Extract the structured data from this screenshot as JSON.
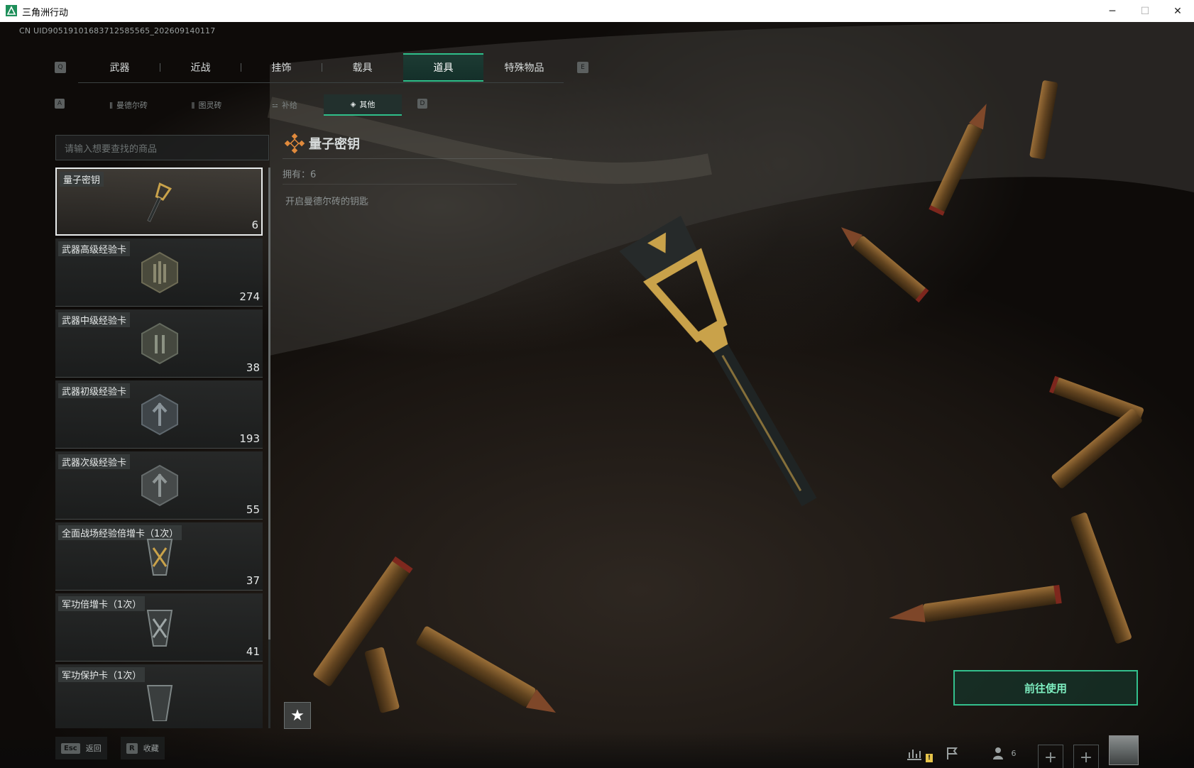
{
  "window": {
    "title": "三角洲行动"
  },
  "uid": "CN UID9051910168371258556​5_202609140117",
  "main_tabs": [
    "武器",
    "近战",
    "挂饰",
    "载具",
    "道具",
    "特殊物品"
  ],
  "main_tab_keys": {
    "prev": "Q",
    "next": "E"
  },
  "sub_tabs": [
    {
      "label": "曼德尔砖",
      "icon": "ǁ"
    },
    {
      "label": "图灵砖",
      "icon": "ǁ"
    },
    {
      "label": "补给",
      "icon": "⚍"
    },
    {
      "label": "其他",
      "icon": "◈"
    }
  ],
  "sub_tab_keys": {
    "prev": "A",
    "next": "D"
  },
  "search": {
    "placeholder": "请输入想要查找的商品"
  },
  "items": [
    {
      "name": "量子密钥",
      "count": "6"
    },
    {
      "name": "武器高级经验卡",
      "count": "274"
    },
    {
      "name": "武器中级经验卡",
      "count": "38"
    },
    {
      "name": "武器初级经验卡",
      "count": "193"
    },
    {
      "name": "武器次级经验卡",
      "count": "55"
    },
    {
      "name": "全面战场经验倍增卡（1次）",
      "count": "37"
    },
    {
      "name": "军功倍增卡（1次）",
      "count": "41"
    },
    {
      "name": "军功保护卡（1次）",
      "count": ""
    }
  ],
  "detail": {
    "title": "量子密钥",
    "owned": "拥有：6",
    "description": "开启曼德尔砖的钥匙"
  },
  "use_button": "前往使用",
  "bottom": {
    "back": {
      "key": "Esc",
      "label": "返回"
    },
    "favorite": {
      "key": "R",
      "label": "收藏"
    },
    "friends_count": "6"
  },
  "colors": {
    "accent": "#2fbf8a",
    "gold": "#c9a24a"
  }
}
